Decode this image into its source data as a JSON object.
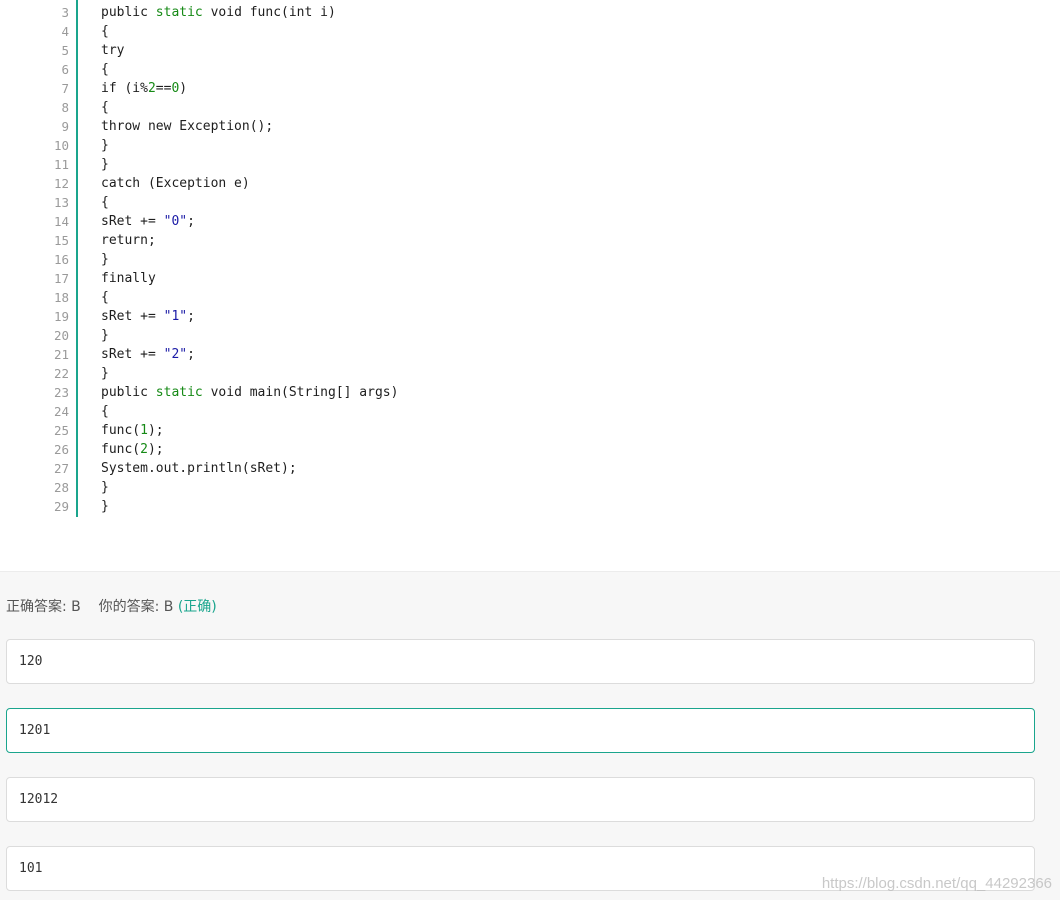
{
  "code": {
    "lines": [
      {
        "num": "3",
        "tokens": [
          {
            "t": "public "
          },
          {
            "t": "static",
            "k": "keyword"
          },
          {
            "t": " void func(int i)"
          }
        ]
      },
      {
        "num": "4",
        "tokens": [
          {
            "t": "{"
          }
        ]
      },
      {
        "num": "5",
        "tokens": [
          {
            "t": "try"
          }
        ]
      },
      {
        "num": "6",
        "tokens": [
          {
            "t": "{"
          }
        ]
      },
      {
        "num": "7",
        "tokens": [
          {
            "t": "if (i%"
          },
          {
            "t": "2",
            "k": "number"
          },
          {
            "t": "=="
          },
          {
            "t": "0",
            "k": "number"
          },
          {
            "t": ")"
          }
        ]
      },
      {
        "num": "8",
        "tokens": [
          {
            "t": "{"
          }
        ]
      },
      {
        "num": "9",
        "tokens": [
          {
            "t": "throw new Exception();"
          }
        ]
      },
      {
        "num": "10",
        "tokens": [
          {
            "t": "}"
          }
        ]
      },
      {
        "num": "11",
        "tokens": [
          {
            "t": "}"
          }
        ]
      },
      {
        "num": "12",
        "tokens": [
          {
            "t": "catch (Exception e)"
          }
        ]
      },
      {
        "num": "13",
        "tokens": [
          {
            "t": "{"
          }
        ]
      },
      {
        "num": "14",
        "tokens": [
          {
            "t": "sRet += "
          },
          {
            "t": "\"0\"",
            "k": "string"
          },
          {
            "t": ";"
          }
        ]
      },
      {
        "num": "15",
        "tokens": [
          {
            "t": "return;"
          }
        ]
      },
      {
        "num": "16",
        "tokens": [
          {
            "t": "}"
          }
        ]
      },
      {
        "num": "17",
        "tokens": [
          {
            "t": "finally"
          }
        ]
      },
      {
        "num": "18",
        "tokens": [
          {
            "t": "{"
          }
        ]
      },
      {
        "num": "19",
        "tokens": [
          {
            "t": "sRet += "
          },
          {
            "t": "\"1\"",
            "k": "string"
          },
          {
            "t": ";"
          }
        ]
      },
      {
        "num": "20",
        "tokens": [
          {
            "t": "}"
          }
        ]
      },
      {
        "num": "21",
        "tokens": [
          {
            "t": "sRet += "
          },
          {
            "t": "\"2\"",
            "k": "string"
          },
          {
            "t": ";"
          }
        ]
      },
      {
        "num": "22",
        "tokens": [
          {
            "t": "}"
          }
        ]
      },
      {
        "num": "23",
        "tokens": [
          {
            "t": "public "
          },
          {
            "t": "static",
            "k": "keyword"
          },
          {
            "t": " void main(String[] args)"
          }
        ]
      },
      {
        "num": "24",
        "tokens": [
          {
            "t": "{"
          }
        ]
      },
      {
        "num": "25",
        "tokens": [
          {
            "t": "func("
          },
          {
            "t": "1",
            "k": "number"
          },
          {
            "t": ");"
          }
        ]
      },
      {
        "num": "26",
        "tokens": [
          {
            "t": "func("
          },
          {
            "t": "2",
            "k": "number"
          },
          {
            "t": ");"
          }
        ]
      },
      {
        "num": "27",
        "tokens": [
          {
            "t": "System.out.println(sRet);"
          }
        ]
      },
      {
        "num": "28",
        "tokens": [
          {
            "t": "}"
          }
        ]
      },
      {
        "num": "29",
        "tokens": [
          {
            "t": "}"
          }
        ]
      }
    ]
  },
  "answer": {
    "correct_label": "正确答案: B",
    "your_label": "你的答案: B",
    "result": "(正确)"
  },
  "options": [
    {
      "text": "120",
      "selected": false
    },
    {
      "text": "1201",
      "selected": true
    },
    {
      "text": "12012",
      "selected": false
    },
    {
      "text": "101",
      "selected": false
    }
  ],
  "watermark": "https://blog.csdn.net/qq_44292366",
  "colors": {
    "accent": "#1aa58d",
    "keyword": "#168a16",
    "string": "#1a1aa6"
  }
}
